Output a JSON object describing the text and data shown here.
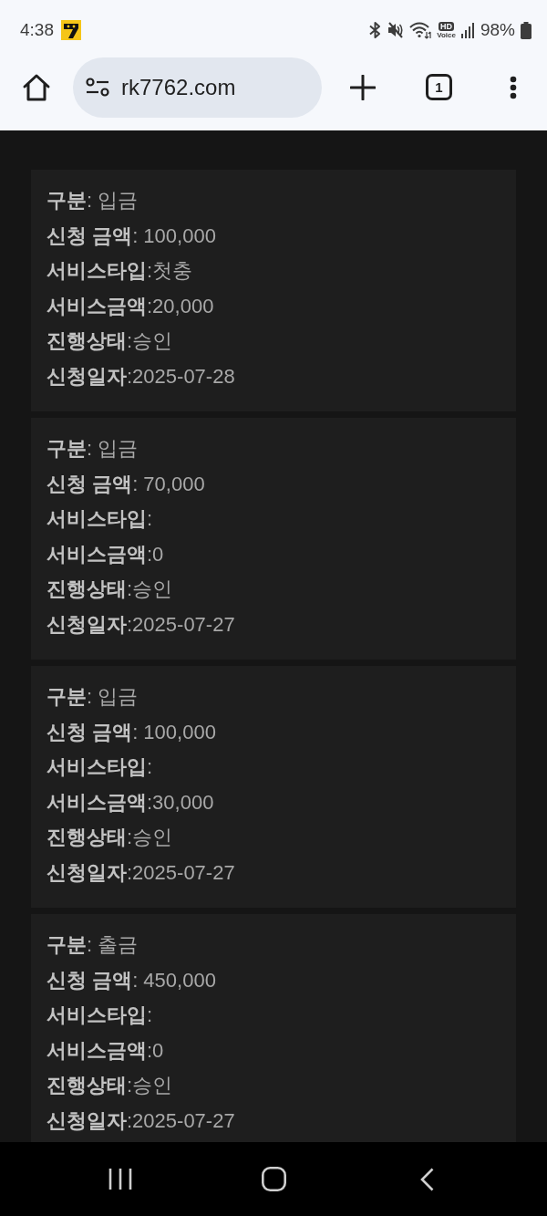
{
  "status_bar": {
    "time": "4:38",
    "hd_badge": "HD",
    "hd_caption": "Voice",
    "battery": "98%"
  },
  "browser_toolbar": {
    "url": "rk7762.com",
    "tab_count": "1"
  },
  "records": [
    {
      "lines": [
        "**구분**: 입금",
        "**신청 금액**: 100,000",
        "**서비스타입**:첫충",
        "**서비스금액**:20,000",
        "**진행상태**:승인",
        "**신청일자**:2025-07-28"
      ]
    },
    {
      "lines": [
        "**구분**: 입금",
        "**신청 금액**: 70,000",
        "**서비스타입**:",
        "**서비스금액**:0",
        "**진행상태**:승인",
        "**신청일자**:2025-07-27"
      ]
    },
    {
      "lines": [
        "**구분**: 입금",
        "**신청 금액**: 100,000",
        "**서비스타입**:",
        "**서비스금액**:30,000",
        "**진행상태**:승인",
        "**신청일자**:2025-07-27"
      ]
    },
    {
      "lines": [
        "**구분**: 출금",
        "**신청 금액**: 450,000",
        "**서비스타입**:",
        "**서비스금액**:0",
        "**진행상태**:승인",
        "**신청일자**:2025-07-27"
      ]
    }
  ]
}
